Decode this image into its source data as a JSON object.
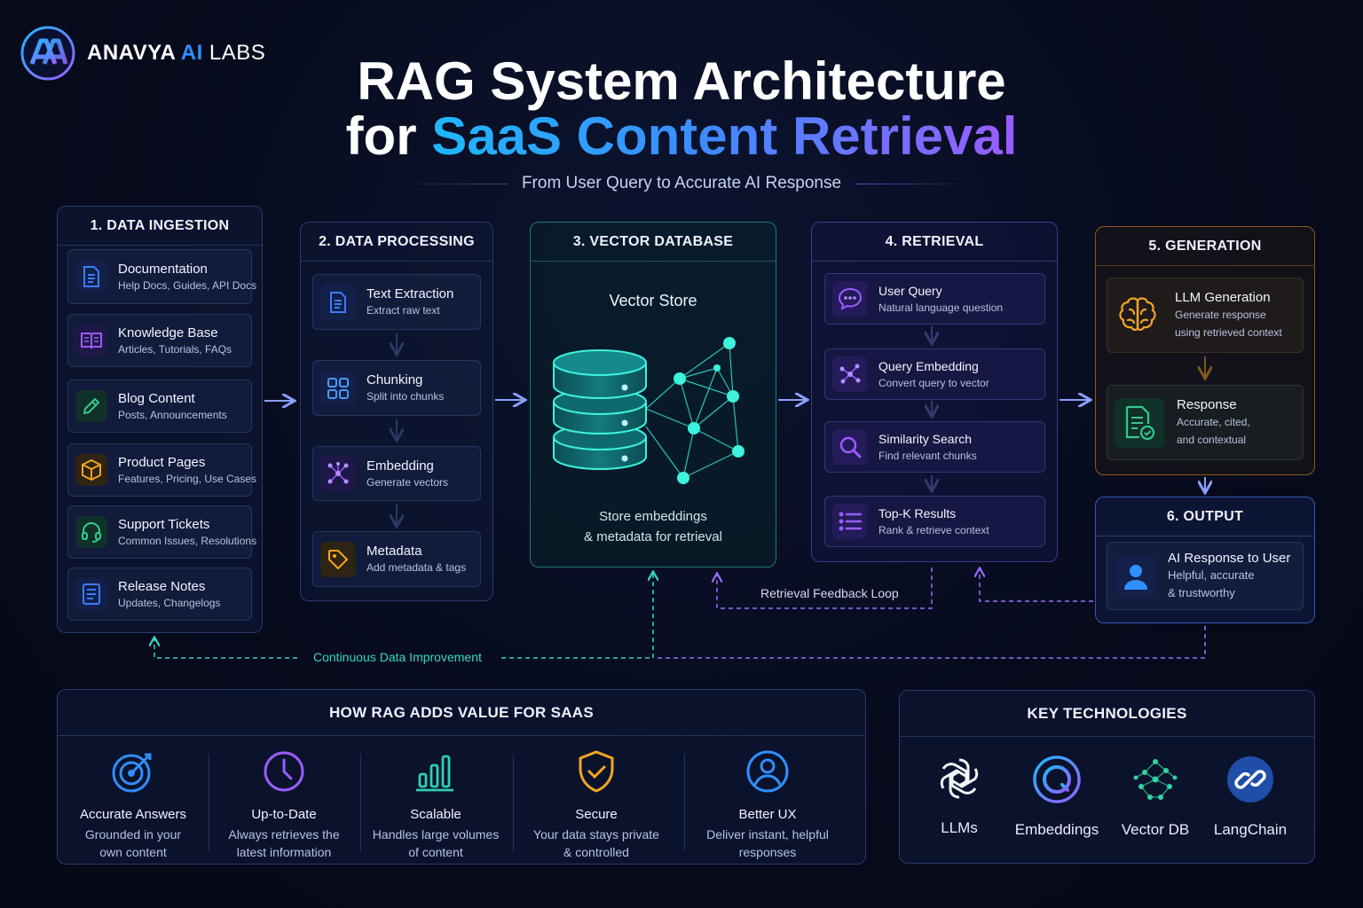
{
  "brand": {
    "part1": "ANAVYA",
    "part2": "AI",
    "part3": "LABS"
  },
  "title": {
    "line1": "RAG System Architecture",
    "line2_plain": "for",
    "line2_highlight": "SaaS Content Retrieval"
  },
  "subtitle": "From User Query to Accurate AI Response",
  "stages": {
    "ingestion": {
      "title": "1. DATA INGESTION",
      "items": [
        {
          "title": "Documentation",
          "sub": "Help Docs, Guides, API Docs",
          "icon": "document-icon",
          "color": "#3d7bff"
        },
        {
          "title": "Knowledge Base",
          "sub": "Articles, Tutorials, FAQs",
          "icon": "book-icon",
          "color": "#9a5cff"
        },
        {
          "title": "Blog Content",
          "sub": "Posts, Announcements",
          "icon": "pencil-icon",
          "color": "#35c98a"
        },
        {
          "title": "Product Pages",
          "sub": "Features, Pricing, Use Cases",
          "icon": "box-icon",
          "color": "#f5a623"
        },
        {
          "title": "Support Tickets",
          "sub": "Common Issues, Resolutions",
          "icon": "headset-icon",
          "color": "#2fd08a"
        },
        {
          "title": "Release Notes",
          "sub": "Updates, Changelogs",
          "icon": "notes-icon",
          "color": "#3d7bff"
        }
      ]
    },
    "processing": {
      "title": "2. DATA PROCESSING",
      "items": [
        {
          "title": "Text Extraction",
          "sub": "Extract raw text",
          "icon": "document-icon",
          "color": "#3d7bff"
        },
        {
          "title": "Chunking",
          "sub": "Split into chunks",
          "icon": "grid-icon",
          "color": "#4a9bff"
        },
        {
          "title": "Embedding",
          "sub": "Generate vectors",
          "icon": "network-icon",
          "color": "#9a5cff"
        },
        {
          "title": "Metadata",
          "sub": "Add metadata & tags",
          "icon": "tag-icon",
          "color": "#f5a623"
        }
      ]
    },
    "vector_db": {
      "title": "3. VECTOR DATABASE",
      "store_title": "Vector Store",
      "desc_line1": "Store embeddings",
      "desc_line2": "& metadata for retrieval"
    },
    "retrieval": {
      "title": "4. RETRIEVAL",
      "items": [
        {
          "title": "User Query",
          "sub": "Natural language question",
          "icon": "chat-icon",
          "color": "#9a5cff"
        },
        {
          "title": "Query Embedding",
          "sub": "Convert query to vector",
          "icon": "network-icon",
          "color": "#9a5cff"
        },
        {
          "title": "Similarity Search",
          "sub": "Find relevant chunks",
          "icon": "search-icon",
          "color": "#9a5cff"
        },
        {
          "title": "Top-K Results",
          "sub": "Rank & retrieve context",
          "icon": "list-icon",
          "color": "#9a5cff"
        }
      ]
    },
    "generation": {
      "title": "5. GENERATION",
      "llm": {
        "title": "LLM Generation",
        "sub1": "Generate response",
        "sub2": "using retrieved context",
        "icon": "brain-icon",
        "color": "#f5a623"
      },
      "response": {
        "title": "Response",
        "sub1": "Accurate, cited,",
        "sub2": "and contextual",
        "icon": "doc-check-icon",
        "color": "#35c98a"
      }
    },
    "output": {
      "title": "6. OUTPUT",
      "item": {
        "title": "AI Response to User",
        "sub1": "Helpful, accurate",
        "sub2": "& trustworthy",
        "icon": "user-icon",
        "color": "#2f8fff"
      }
    }
  },
  "loops": {
    "retrieval_feedback": "Retrieval Feedback Loop",
    "continuous": "Continuous Data Improvement"
  },
  "value": {
    "title": "HOW RAG ADDS VALUE FOR SAAS",
    "items": [
      {
        "title": "Accurate Answers",
        "sub1": "Grounded in your",
        "sub2": "own content",
        "icon": "target-icon",
        "color": "#2f8fff"
      },
      {
        "title": "Up-to-Date",
        "sub1": "Always retrieves the",
        "sub2": "latest information",
        "icon": "clock-icon",
        "color": "#9a5cff"
      },
      {
        "title": "Scalable",
        "sub1": "Handles large volumes",
        "sub2": "of content",
        "icon": "bar-chart-icon",
        "color": "#2fd0b0"
      },
      {
        "title": "Secure",
        "sub1": "Your data stays private",
        "sub2": "& controlled",
        "icon": "shield-icon",
        "color": "#f5a623"
      },
      {
        "title": "Better UX",
        "sub1": "Deliver instant, helpful",
        "sub2": "responses",
        "icon": "user-circle-icon",
        "color": "#2f8fff"
      }
    ]
  },
  "tech": {
    "title": "KEY TECHNOLOGIES",
    "items": [
      {
        "label": "LLMs",
        "icon": "openai-icon"
      },
      {
        "label": "Embeddings",
        "icon": "embeddings-icon"
      },
      {
        "label": "Vector DB",
        "icon": "graph-icon"
      },
      {
        "label": "LangChain",
        "icon": "link-icon"
      }
    ]
  },
  "colors": {
    "accent_blue": "#2f8fff",
    "accent_purple": "#9a5cff",
    "teal": "#2fd6c4",
    "orange": "#f5a623"
  }
}
